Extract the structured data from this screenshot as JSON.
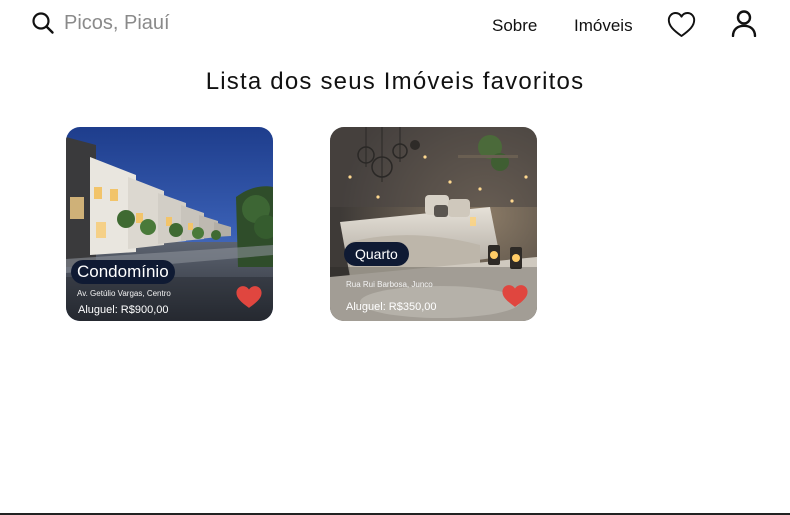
{
  "header": {
    "search": {
      "placeholder": "Picos, Piauí",
      "value": ""
    },
    "nav": {
      "about_label": "Sobre",
      "properties_label": "Imóveis"
    },
    "icons": [
      "search-icon",
      "heart-outline-icon",
      "user-icon"
    ]
  },
  "main": {
    "title": "Lista dos seus Imóveis favoritos",
    "cards": [
      {
        "type_label": "Condomínio",
        "address": "Av. Getúlio Vargas, Centro",
        "price": "Aluguel: R$900,00",
        "favorite_icon": "heart-filled-icon"
      },
      {
        "type_label": "Quarto",
        "address": "Rua Rui Barbosa, Junco",
        "price": "Aluguel: R$350,00",
        "favorite_icon": "heart-filled-icon"
      }
    ]
  },
  "colors": {
    "badge_background": "#0f1a33",
    "favorite_heart": "#e0463f",
    "text": "#111111"
  }
}
